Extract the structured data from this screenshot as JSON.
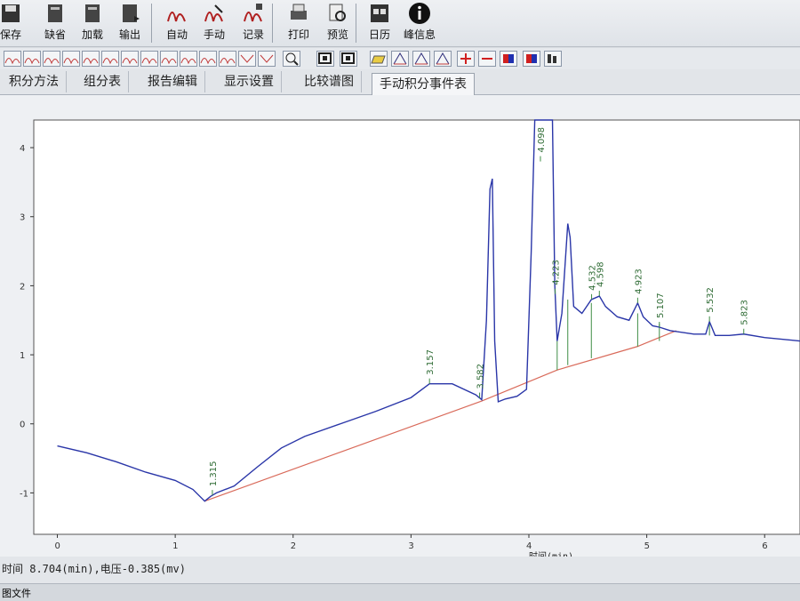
{
  "toolbar": {
    "buttons": [
      {
        "label": "保存",
        "icon": "floppy-icon"
      },
      {
        "label": "缺省",
        "icon": "default-icon"
      },
      {
        "label": "加载",
        "icon": "load-icon"
      },
      {
        "label": "输出",
        "icon": "output-icon"
      },
      {
        "label": "自动",
        "icon": "auto-integrate-icon"
      },
      {
        "label": "手动",
        "icon": "manual-integrate-icon"
      },
      {
        "label": "记录",
        "icon": "record-icon"
      },
      {
        "label": "打印",
        "icon": "printer-icon"
      },
      {
        "label": "预览",
        "icon": "preview-icon"
      },
      {
        "label": "日历",
        "icon": "calendar-icon"
      },
      {
        "label": "峰信息",
        "icon": "info-icon"
      }
    ]
  },
  "tabs": [
    "积分方法",
    "组分表",
    "报告编辑",
    "显示设置",
    "比较谱图",
    "手动积分事件表"
  ],
  "status": {
    "text": "时间 8.704(min),电压-0.385(mv)"
  },
  "bottom": {
    "text": "图文件"
  },
  "chart_data": {
    "type": "line",
    "xlabel": "时间(min)",
    "ylabel": "",
    "xlim": [
      -0.2,
      6.3
    ],
    "ylim": [
      -1.6,
      4.4
    ],
    "xticks": [
      0,
      1,
      2,
      3,
      4,
      5,
      6
    ],
    "yticks": [
      -1,
      0,
      1,
      2,
      3,
      4
    ],
    "colors": {
      "signal": "#2a36a8",
      "baseline": "#d96a5a",
      "marker": "#3f8d46"
    },
    "series": [
      {
        "values": [
          [
            0,
            -0.32
          ],
          [
            0.25,
            -0.42
          ],
          [
            0.5,
            -0.55
          ],
          [
            0.75,
            -0.7
          ],
          [
            1.0,
            -0.82
          ],
          [
            1.15,
            -0.95
          ],
          [
            1.25,
            -1.12
          ],
          [
            1.3,
            -1.05
          ],
          [
            1.35,
            -1.0
          ],
          [
            1.5,
            -0.9
          ],
          [
            1.7,
            -0.62
          ],
          [
            1.9,
            -0.35
          ],
          [
            2.1,
            -0.18
          ],
          [
            2.4,
            0.0
          ],
          [
            2.7,
            0.18
          ],
          [
            3.0,
            0.38
          ],
          [
            3.157,
            0.58
          ],
          [
            3.35,
            0.58
          ],
          [
            3.55,
            0.42
          ],
          [
            3.6,
            0.35
          ],
          [
            3.64,
            1.5
          ],
          [
            3.67,
            3.4
          ],
          [
            3.69,
            3.55
          ],
          [
            3.71,
            1.2
          ],
          [
            3.74,
            0.32
          ],
          [
            3.8,
            0.36
          ],
          [
            3.9,
            0.4
          ],
          [
            3.98,
            0.5
          ],
          [
            4.02,
            2.5
          ],
          [
            4.05,
            4.6
          ],
          [
            4.2,
            4.6
          ],
          [
            4.22,
            2.0
          ],
          [
            4.24,
            1.2
          ],
          [
            4.28,
            1.6
          ],
          [
            4.33,
            2.9
          ],
          [
            4.35,
            2.7
          ],
          [
            4.38,
            1.7
          ],
          [
            4.45,
            1.6
          ],
          [
            4.53,
            1.8
          ],
          [
            4.598,
            1.85
          ],
          [
            4.65,
            1.7
          ],
          [
            4.75,
            1.55
          ],
          [
            4.85,
            1.5
          ],
          [
            4.923,
            1.75
          ],
          [
            4.97,
            1.55
          ],
          [
            5.05,
            1.42
          ],
          [
            5.107,
            1.4
          ],
          [
            5.2,
            1.35
          ],
          [
            5.4,
            1.3
          ],
          [
            5.5,
            1.3
          ],
          [
            5.532,
            1.48
          ],
          [
            5.58,
            1.28
          ],
          [
            5.7,
            1.28
          ],
          [
            5.823,
            1.3
          ],
          [
            6.0,
            1.25
          ],
          [
            6.3,
            1.2
          ]
        ]
      }
    ],
    "peaks": [
      {
        "x": 1.315,
        "label": "1.315"
      },
      {
        "x": 3.157,
        "label": "3.157"
      },
      {
        "x": 3.582,
        "label": "3.582"
      },
      {
        "x": 4.098,
        "label": "4.098"
      },
      {
        "x": 4.223,
        "label": "4.223"
      },
      {
        "x": 4.532,
        "label": "4.532"
      },
      {
        "x": 4.598,
        "label": "4.598"
      },
      {
        "x": 4.923,
        "label": "4.923"
      },
      {
        "x": 5.107,
        "label": "5.107"
      },
      {
        "x": 5.532,
        "label": "5.532"
      },
      {
        "x": 5.823,
        "label": "5.823"
      }
    ],
    "baseline": [
      [
        1.25,
        -1.12
      ],
      [
        3.6,
        0.33
      ],
      [
        4.24,
        0.78
      ],
      [
        4.92,
        1.12
      ],
      [
        5.25,
        1.35
      ]
    ],
    "drop_lines": [
      [
        4.24,
        0.78,
        1.2
      ],
      [
        4.33,
        0.85,
        1.8
      ],
      [
        4.53,
        0.95,
        1.75
      ],
      [
        4.923,
        1.12,
        1.6
      ],
      [
        5.107,
        1.2,
        1.45
      ],
      [
        5.532,
        1.28,
        1.48
      ]
    ]
  }
}
